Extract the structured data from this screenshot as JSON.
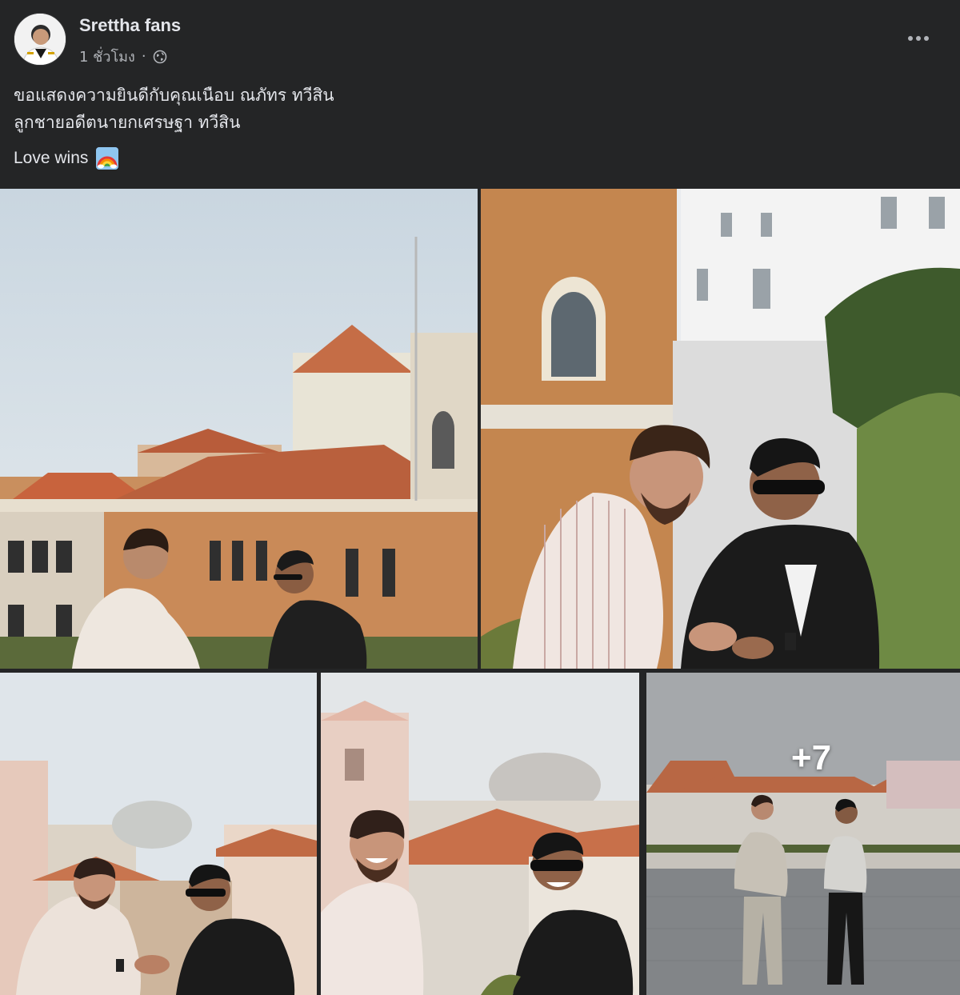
{
  "post": {
    "author": "Srettha fans",
    "time": "1 ชั่วโมง",
    "separator": "·",
    "privacy_icon": "globe-icon",
    "more_icon": "more-horizontal-icon",
    "text_lines": "ขอแสดงความยินดีกับคุณเนือบ ณภัทร ทวีสิน\nลูกชายอดีตนายกเศรษฐา ทวีสิน",
    "love_text": "Love wins",
    "emoji": "rainbow-emoji"
  },
  "photos": {
    "count": 5,
    "more_count": "+7"
  },
  "colors": {
    "background": "#242526",
    "text_primary": "#e4e6eb",
    "text_secondary": "#b0b3b8"
  }
}
